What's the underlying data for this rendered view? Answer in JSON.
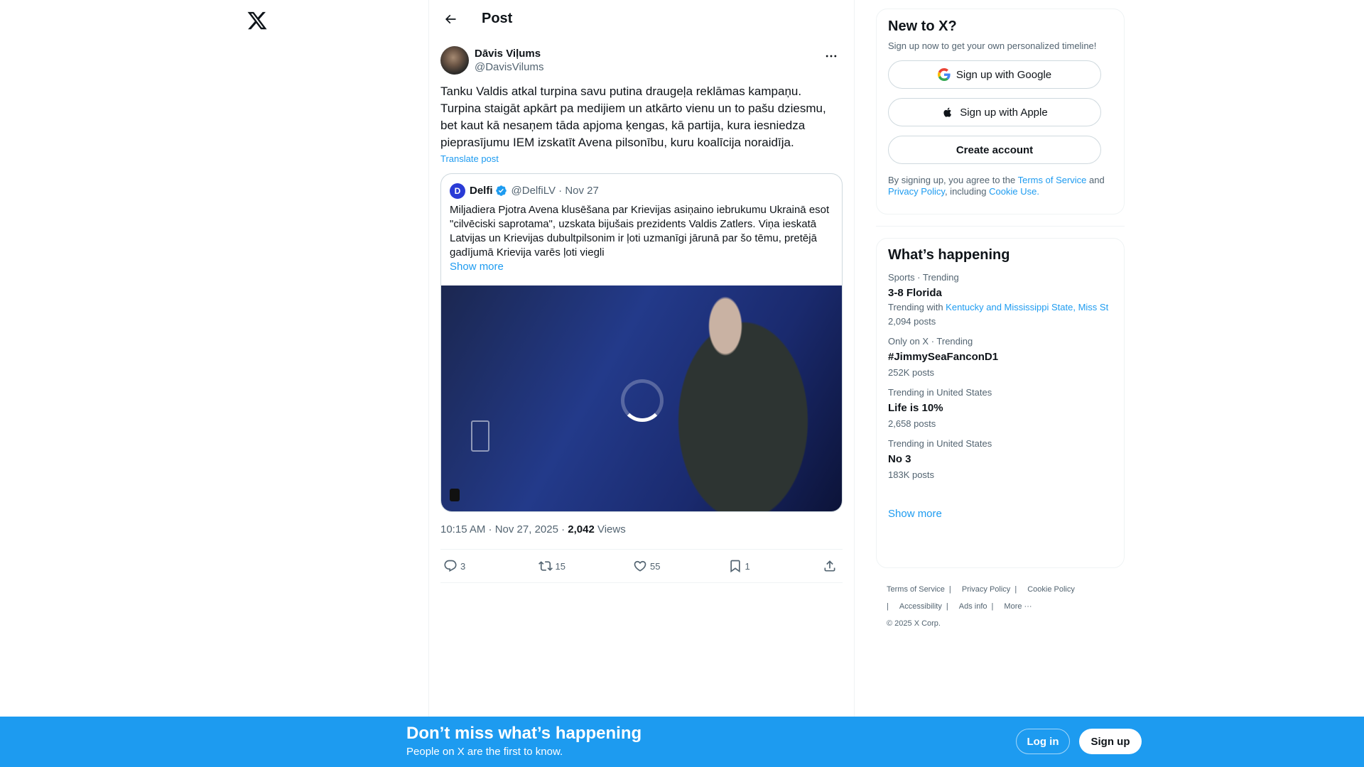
{
  "post_header": {
    "title": "Post"
  },
  "post": {
    "author_name": "Dāvis Viļums",
    "author_handle": "@DavisVilums",
    "text": "Tanku Valdis atkal turpina savu putina draugeļa reklāmas kampaņu. Turpina staigāt apkārt pa medijiem un atkārto vienu un to pašu dziesmu, bet kaut kā nesaņem tāda apjoma ķengas, kā partija, kura iesniedza pieprasījumu IEM izskatīt Avena pilsonību, kuru koalīcija noraidīja.",
    "translate_label": "Translate post",
    "time": "10:15 AM · Nov 27, 2025 · ",
    "views_count": "2,042",
    "views_label": " Views",
    "replies": "3",
    "reposts": "15",
    "likes": "55",
    "bookmarks": "1"
  },
  "quote": {
    "avatar_letter": "D",
    "name": "Delfi",
    "meta": "@DelfiLV · Nov 27",
    "text": "Miljadiera Pjotra Avena klusēšana par Krievijas asiņaino iebrukumu Ukrainā esot \"cilvēciski saprotama\", uzskata bijušais prezidents Valdis Zatlers. Viņa ieskatā Latvijas un Krievijas dubultpilsonim ir ļoti uzmanīgi jārunā par šo tēmu, pretējā gadījumā Krievija varēs ļoti viegli",
    "show_more": "Show more"
  },
  "signup": {
    "title": "New to X?",
    "subtitle": "Sign up now to get your own personalized timeline!",
    "google": "Sign up with Google",
    "apple": "Sign up with Apple",
    "create": "Create account",
    "terms_prefix": "By signing up, you agree to the ",
    "terms_link": "Terms of Service",
    "terms_and": " and ",
    "privacy_link": "Privacy Policy",
    "including": ", including ",
    "cookie_link": "Cookie Use",
    "period": "."
  },
  "trends": {
    "title": "What’s happening",
    "items": [
      {
        "context": "Sports · Trending",
        "name": "3-8 Florida",
        "with_prefix": "Trending with ",
        "with_links": "Kentucky and Mississippi State, Miss St",
        "posts": "2,094 posts"
      },
      {
        "context": "Only on X · Trending",
        "name": "#JimmySeaFanconD1",
        "posts": "252K posts"
      },
      {
        "context": "Trending in United States",
        "name": "Life is 10%",
        "posts": "2,658 posts"
      },
      {
        "context": "Trending in United States",
        "name": "No 3",
        "posts": "183K posts"
      }
    ],
    "show_more": "Show more"
  },
  "footer": {
    "terms": "Terms of Service",
    "privacy": "Privacy Policy",
    "cookie": "Cookie Policy",
    "accessibility": "Accessibility",
    "ads": "Ads info",
    "more": "More ···",
    "copyright": "© 2025 X Corp."
  },
  "bottom_bar": {
    "title": "Don’t miss what’s happening",
    "subtitle": "People on X are the first to know.",
    "login": "Log in",
    "signup": "Sign up"
  },
  "icons": {
    "logo": "x-logo-icon",
    "back": "arrow-left-icon",
    "more": "ellipsis-icon",
    "verified": "verified-badge-icon",
    "reply": "reply-icon",
    "repost": "repost-icon",
    "like": "heart-icon",
    "bookmark": "bookmark-icon",
    "share": "share-icon",
    "google": "google-icon",
    "apple": "apple-icon"
  },
  "colors": {
    "accent": "#1d9bf0",
    "text": "#0f1419",
    "secondary": "#536471",
    "border": "#eff3f4"
  }
}
